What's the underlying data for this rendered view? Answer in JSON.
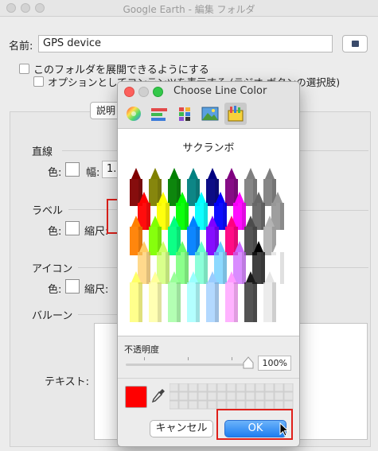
{
  "window": {
    "title": "Google Earth - 編集 フォルダ"
  },
  "form": {
    "name_label": "名前:",
    "name_value": "GPS device",
    "expand_checkbox_label": "このフォルダを展開できるようにする",
    "options_checkbox_label": "オプションとしてコンテンツを表示する (ラジオ ボタンの選択肢)",
    "tab_description": "説明"
  },
  "sections": {
    "line": {
      "title": "直線",
      "color_label": "色:",
      "width_label": "幅:",
      "width_value": "1.0"
    },
    "label": {
      "title": "ラベル",
      "color_label": "色:",
      "scale_label": "縮尺:"
    },
    "icon": {
      "title": "アイコン",
      "color_label": "色:",
      "scale_label": "縮尺:"
    },
    "balloon": {
      "title": "バルーン",
      "text_label": "テキスト:"
    }
  },
  "color_panel": {
    "title": "Choose Line Color",
    "crayon_name": "サクランボ",
    "opacity_label": "不透明度",
    "opacity_value": "100%",
    "cancel_label": "キャンセル",
    "ok_label": "OK",
    "selected_color": "#ff0000",
    "modes": [
      "color-wheel-icon",
      "color-sliders-icon",
      "color-palettes-icon",
      "image-palettes-icon",
      "crayons-icon"
    ],
    "crayon_rows": [
      [
        "#800000",
        "#808000",
        "#008000",
        "#008080",
        "#000080",
        "#800080",
        "#7f7f7f",
        "#808080"
      ],
      [
        "#ff0000",
        "#ffff00",
        "#00ff00",
        "#00ffff",
        "#0000ff",
        "#ff00ff",
        "#666666",
        "#999999"
      ],
      [
        "#ff8000",
        "#80ff00",
        "#00ff80",
        "#0080ff",
        "#8000ff",
        "#ff0080",
        "#4c4c4c",
        "#b3b3b3"
      ],
      [
        "#ffcc66",
        "#ccff66",
        "#66ff66",
        "#66ffcc",
        "#66ccff",
        "#cc66ff",
        "#000000",
        "#ffffff"
      ],
      [
        "#ffff66",
        "#ffff99",
        "#99ff99",
        "#99ffff",
        "#99ccff",
        "#ff99ff",
        "#191919",
        "#e6e6e6"
      ]
    ]
  }
}
